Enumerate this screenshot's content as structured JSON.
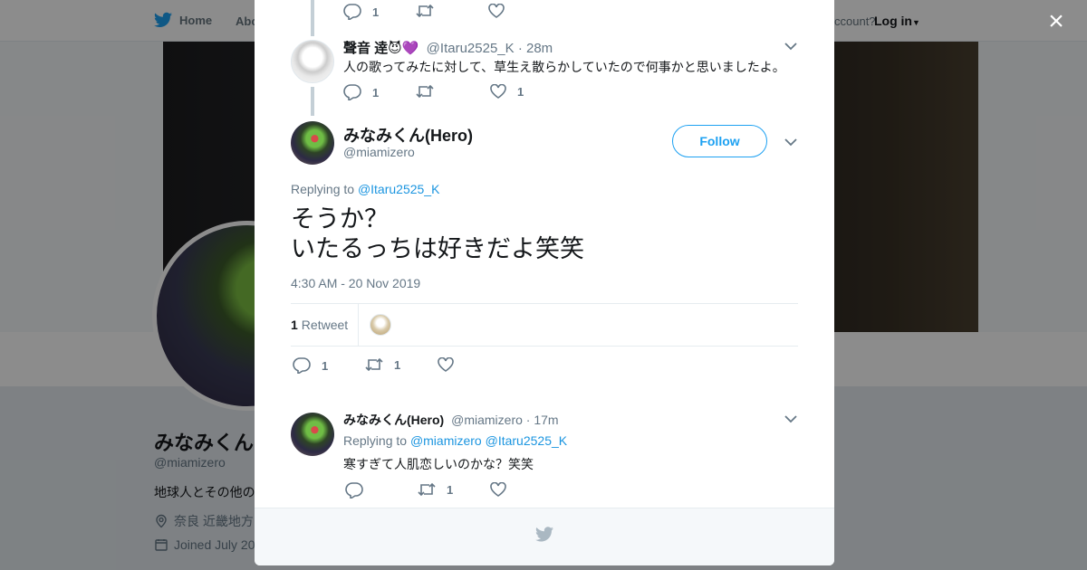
{
  "background": {
    "nav": {
      "home": "Home",
      "about": "Abo",
      "account": "ccount?",
      "login": "Log in"
    },
    "profile": {
      "name": "みなみくん",
      "handle": "@miamizero",
      "bio": "地球人とその他の",
      "location": "奈良 近畿地方",
      "joined": "Joined July 20"
    }
  },
  "modal": {
    "close_icon": "×",
    "tweets": [
      {
        "author": "聲音 逹",
        "emoji": "😈💜",
        "handle": "@Itaru2525_K",
        "time": "· 28m",
        "text": "人の歌ってみたに対して、草生え散らかしていたので何事かと思いましたよ。",
        "replies": "1",
        "retweets": "",
        "likes": "1"
      }
    ],
    "above_actions": {
      "replies": "1"
    },
    "main_tweet": {
      "author": "みなみくん(Hero)",
      "handle": "@miamizero",
      "follow_label": "Follow",
      "replying_prefix": "Replying to",
      "replying_to": "@Itaru2525_K",
      "text_line1": "そうか？",
      "text_line2": "いたるっちは好きだよ笑笑",
      "timestamp": "4:30 AM - 20 Nov 2019",
      "retweet_count": "1",
      "retweet_label": "Retweet",
      "actions": {
        "replies": "1",
        "retweets": "1",
        "likes": ""
      }
    },
    "reply": {
      "author": "みなみくん(Hero)",
      "handle": "@miamizero",
      "time": "· 17m",
      "replying_prefix": "Replying to",
      "replying_to_1": "@miamizero",
      "replying_to_2": "@Itaru2525_K",
      "text": "寒すぎて人肌恋しいのかな？笑笑",
      "actions": {
        "replies": "",
        "retweets": "1",
        "likes": ""
      }
    }
  },
  "colors": {
    "accent": "#1da1f2",
    "link": "#1b95e0",
    "muted": "#657786",
    "thread": "#c4cfd6"
  }
}
